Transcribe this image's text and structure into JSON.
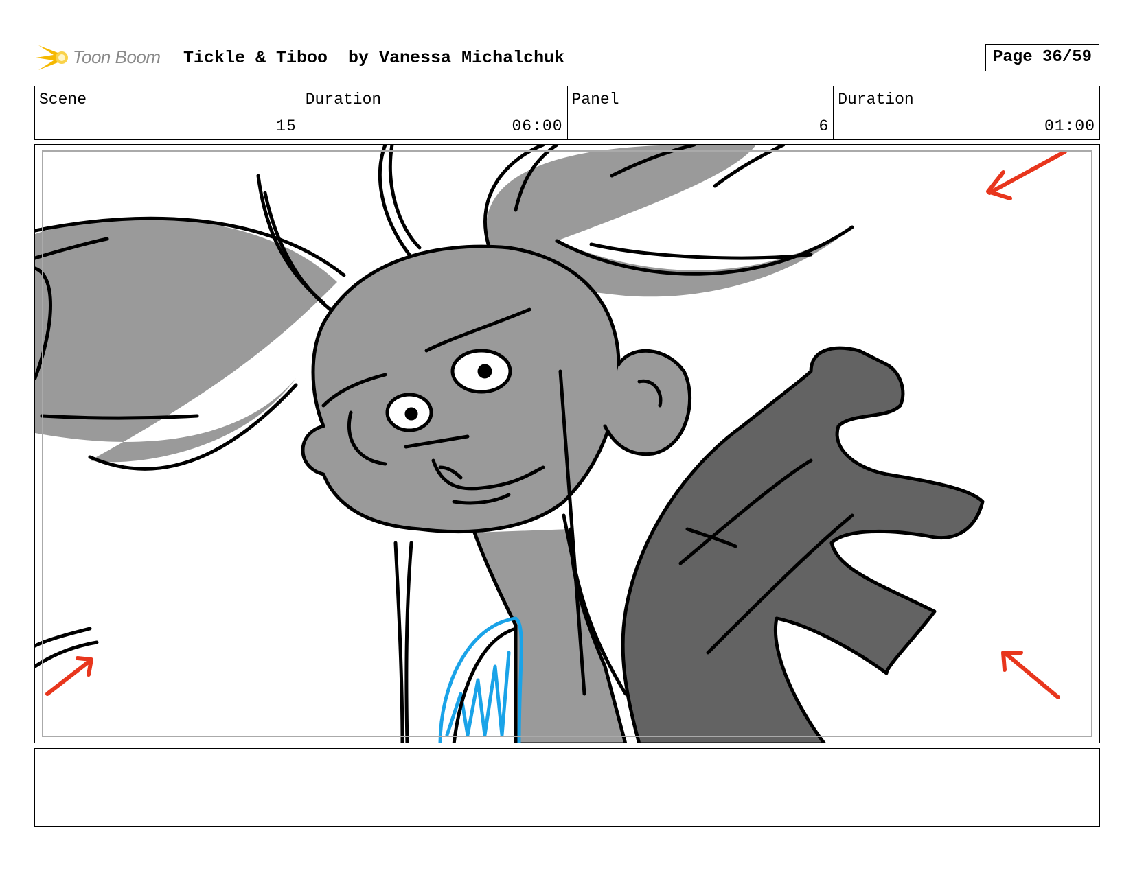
{
  "header": {
    "logo_text": "Toon Boom",
    "title": "Tickle & Tiboo  by Vanessa Michalchuk",
    "page": "Page 36/59"
  },
  "info": [
    {
      "label": "Scene",
      "value": "15"
    },
    {
      "label": "Duration",
      "value": "06:00"
    },
    {
      "label": "Panel",
      "value": "6"
    },
    {
      "label": "Duration",
      "value": "01:00"
    }
  ],
  "colors": {
    "arrow": "#e8361d",
    "ink_blue": "#1aa3e8",
    "tone_light": "#9a9a9a",
    "tone_dark": "#636363"
  },
  "notes": ""
}
